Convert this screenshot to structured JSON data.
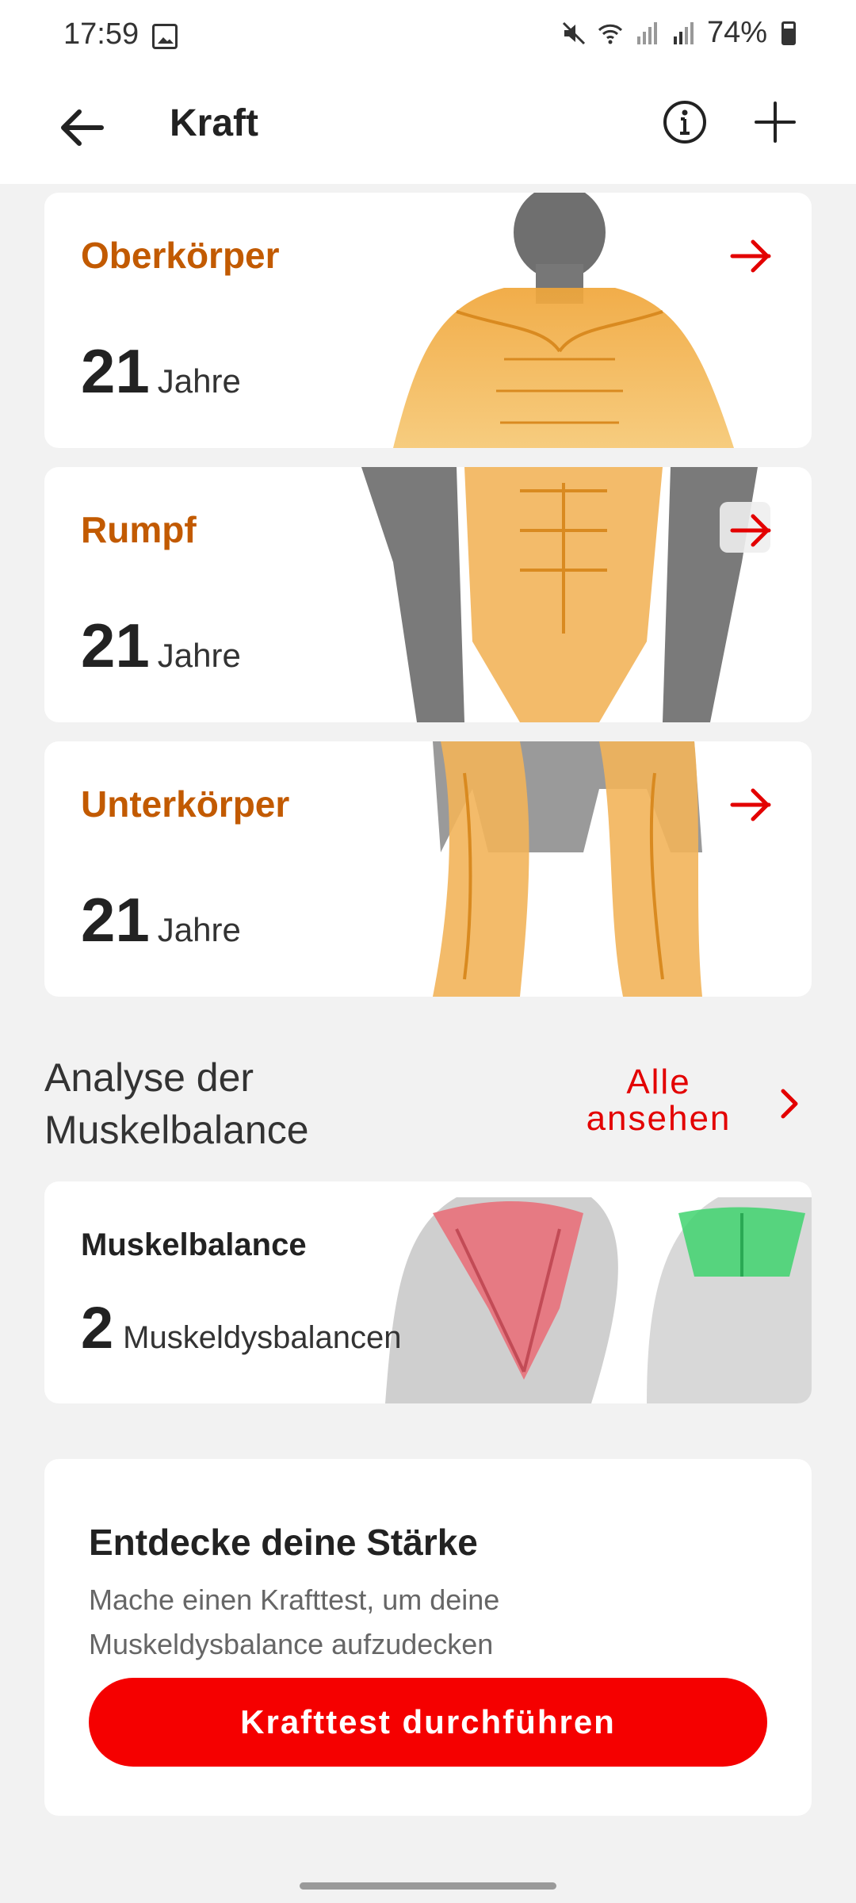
{
  "status_bar": {
    "time": "17:59",
    "battery": "74%"
  },
  "header": {
    "title": "Kraft"
  },
  "strength_cards": [
    {
      "title": "Oberkörper",
      "value": "21",
      "unit": "Jahre"
    },
    {
      "title": "Rumpf",
      "value": "21",
      "unit": "Jahre"
    },
    {
      "title": "Unterkörper",
      "value": "21",
      "unit": "Jahre"
    }
  ],
  "balance_section": {
    "title_line1": "Analyse der",
    "title_line2": "Muskelbalance",
    "see_all_line1": "Alle",
    "see_all_line2": "ansehen",
    "card_title": "Muskelbalance",
    "card_value": "2",
    "card_unit": "Muskeldysbalancen"
  },
  "discover_card": {
    "title": "Entdecke deine Stärke",
    "text_line1": "Mache einen Krafttest, um deine",
    "text_line2": "Muskeldysbalance aufzudecken",
    "button_label": "Krafttest durchführen"
  },
  "colors": {
    "accent": "#e30000",
    "title_orange": "#c25a00",
    "cta": "#f50000"
  }
}
